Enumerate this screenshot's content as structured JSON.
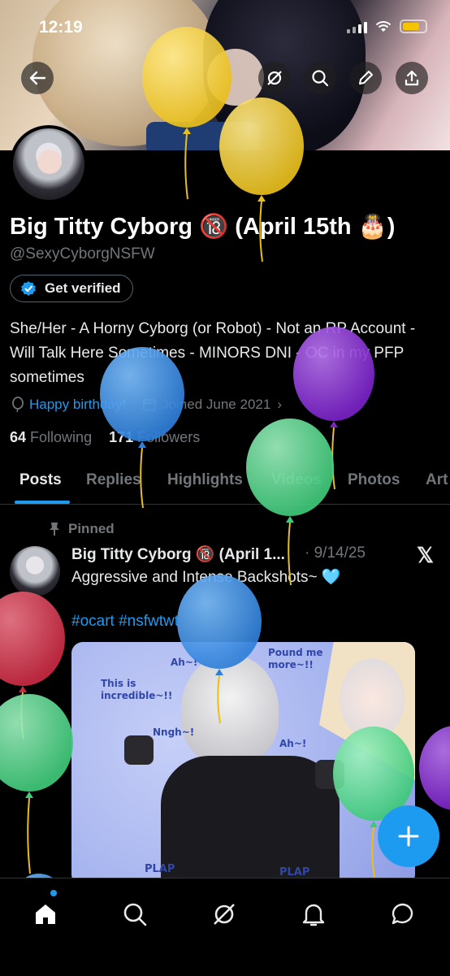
{
  "status": {
    "time": "12:19"
  },
  "profile": {
    "name": "Big Titty Cyborg 🔞 (April 15th 🎂)",
    "handle": "@SexyCyborgNSFW",
    "verify_label": "Get verified",
    "bio": "She/Her - A Horny Cyborg (or Robot) - Not an RP Account - Will Talk Here Sometimes - MINORS DNI - OC in my PFP sometimes",
    "birthday": "Happy birthday!",
    "joined": "Joined June 2021",
    "following_count": "64",
    "following_label": "Following",
    "followers_count": "171",
    "followers_label": "Followers"
  },
  "tabs": [
    "Posts",
    "Replies",
    "Highlights",
    "Videos",
    "Photos",
    "Art"
  ],
  "post": {
    "pinned_label": "Pinned",
    "author": "Big Titty Cyborg 🔞 (April 1...",
    "date": "· 9/14/25",
    "text": "Aggressive and Intense Backshots~ 🩵",
    "tags": "#ocart #nsfwtwt",
    "image_text": {
      "a": "Ah~!",
      "b": "Pound me more~!!",
      "c": "This is incredible~!!",
      "d": "Nngh~!",
      "e": "Ah~!",
      "f": "PLAP",
      "g": "PLAP"
    }
  },
  "colors": {
    "accent": "#1d9bf0",
    "muted": "#71767b",
    "text": "#e7e9ea"
  },
  "icons": [
    "back-arrow-icon",
    "grok-icon",
    "search-icon",
    "edit-pencil-icon",
    "share-icon",
    "home-icon",
    "explore-icon",
    "notifications-icon",
    "messages-icon",
    "compose-icon",
    "x-logo-icon",
    "pin-icon",
    "verified-badge-icon",
    "balloon-icon",
    "calendar-icon"
  ]
}
